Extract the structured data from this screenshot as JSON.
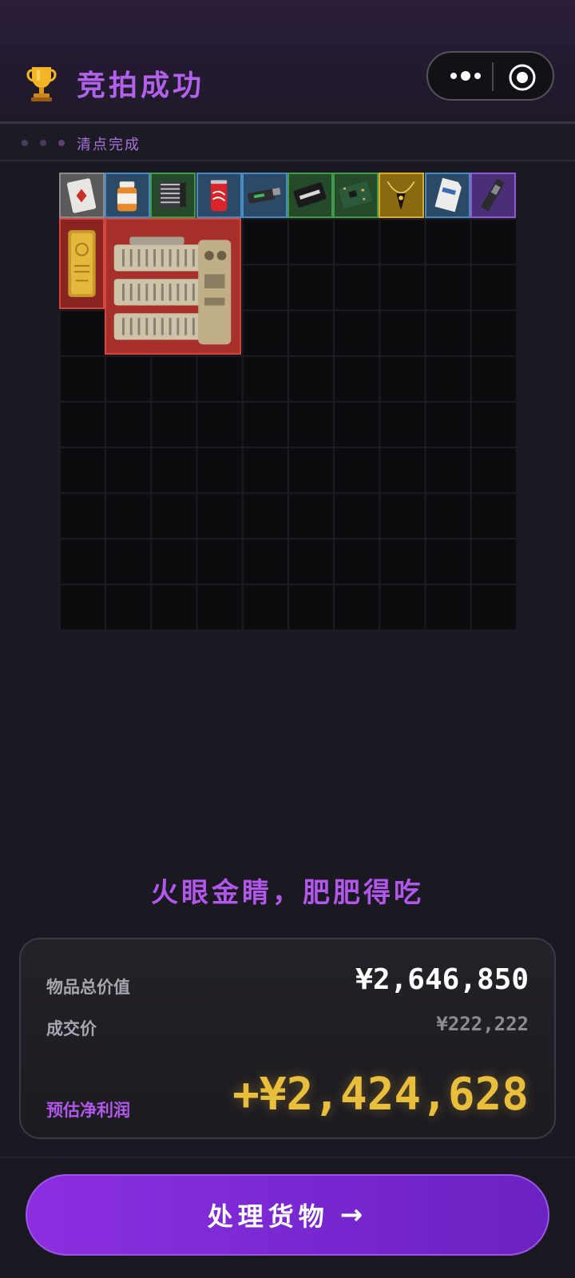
{
  "header": {
    "title": "竞拍成功",
    "icon": "trophy-icon"
  },
  "capsule": {
    "more_icon": "more-dots-icon",
    "close_icon": "target-close-icon"
  },
  "status": {
    "label": "清点完成"
  },
  "grid": {
    "columns": 10,
    "rows": 10
  },
  "items": [
    {
      "name": "playing-card-item",
      "rarity": "gray"
    },
    {
      "name": "pill-bottle-item",
      "rarity": "blue"
    },
    {
      "name": "cpu-cooler-item",
      "rarity": "green"
    },
    {
      "name": "cola-can-item",
      "rarity": "blue"
    },
    {
      "name": "usb-drive-item",
      "rarity": "blue"
    },
    {
      "name": "good-luck-box-item",
      "rarity": "green"
    },
    {
      "name": "circuit-board-item",
      "rarity": "green"
    },
    {
      "name": "gold-necklace-item",
      "rarity": "gold"
    },
    {
      "name": "sd-card-item",
      "rarity": "blue"
    },
    {
      "name": "ssd-item",
      "rarity": "purple"
    },
    {
      "name": "gold-bar-item",
      "rarity": "red"
    },
    {
      "name": "server-battery-item",
      "rarity": "red"
    }
  ],
  "colors": {
    "gray": "#8a8a8a",
    "blue": "#4a8ac0",
    "green": "#3f9a4a",
    "gold": "#d6ae2a",
    "purple": "#8e5ad4",
    "red": "#d4453e",
    "accent": "#b158ea",
    "profit": "#e8be3c"
  },
  "slogan": "火眼金睛，肥肥得吃",
  "summary": {
    "total_label": "物品总价值",
    "total_value": "¥2,646,850",
    "deal_label": "成交价",
    "deal_value": "¥222,222",
    "profit_label": "预估净利润",
    "profit_value": "+¥2,424,628"
  },
  "action": {
    "label": "处理货物",
    "arrow": "→"
  }
}
